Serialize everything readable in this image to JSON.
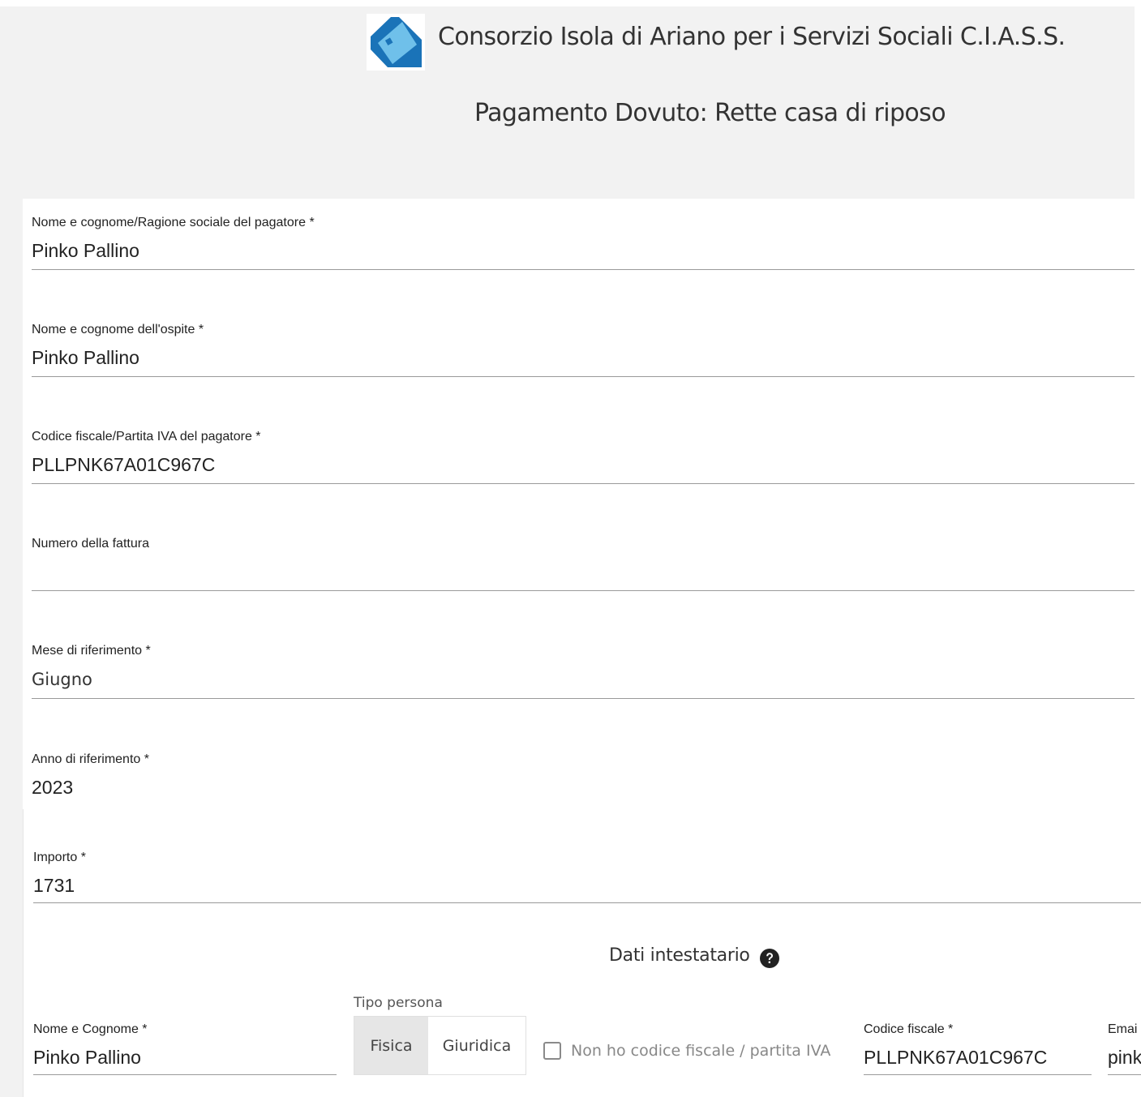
{
  "header": {
    "org_name": "Consorzio Isola di Ariano per i Servizi Sociali C.I.A.S.S.",
    "page_title": "Pagamento Dovuto: Rette casa di riposo",
    "logo_colors": {
      "blue": "#1a73b8",
      "light_blue": "#6fc0ea",
      "white": "#ffffff"
    }
  },
  "form": {
    "payer_name": {
      "label": "Nome e cognome/Ragione sociale del pagatore *",
      "value": "Pinko Pallino"
    },
    "guest_name": {
      "label": "Nome e cognome dell'ospite *",
      "value": "Pinko Pallino"
    },
    "payer_tax_code": {
      "label": "Codice fiscale/Partita IVA del pagatore *",
      "value": "PLLPNK67A01C967C"
    },
    "invoice_number": {
      "label": "Numero della fattura",
      "value": ""
    },
    "reference_month": {
      "label": "Mese di riferimento *",
      "value": "Giugno"
    },
    "reference_year": {
      "label": "Anno di riferimento *",
      "value": "2023"
    },
    "amount": {
      "label": "Importo *",
      "value": "1731"
    }
  },
  "holder": {
    "section_title": "Dati intestatario",
    "help_icon": "question-circle-icon",
    "full_name": {
      "label": "Nome e Cognome *",
      "value": "Pinko Pallino"
    },
    "person_type": {
      "label": "Tipo persona",
      "options": [
        "Fisica",
        "Giuridica"
      ],
      "selected": "Fisica"
    },
    "no_tax_code": {
      "label": "Non ho codice fiscale / partita IVA",
      "checked": false
    },
    "tax_code": {
      "label": "Codice fiscale *",
      "value": "PLLPNK67A01C967C"
    },
    "email": {
      "label": "Emai",
      "value": "pink"
    }
  }
}
